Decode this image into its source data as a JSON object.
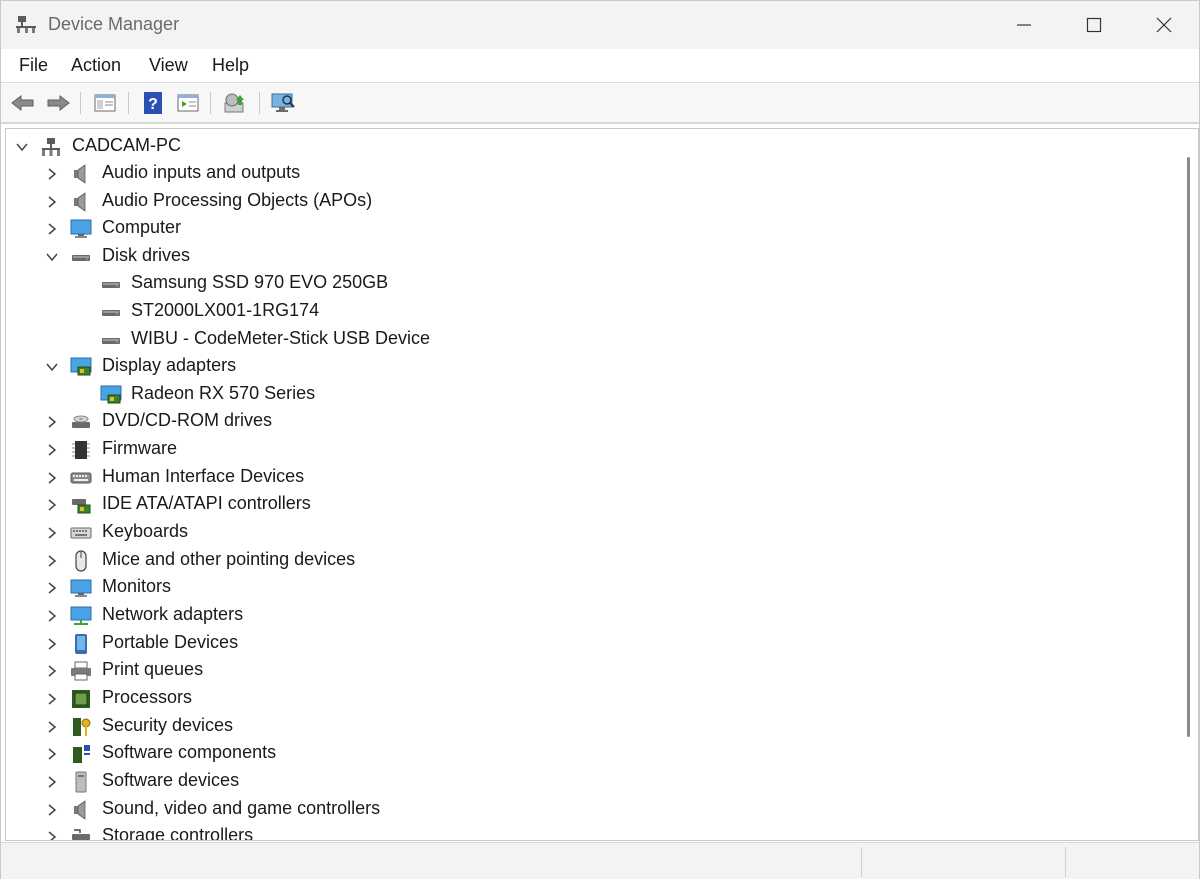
{
  "window": {
    "title": "Device Manager"
  },
  "menu": {
    "items": [
      "File",
      "Action",
      "View",
      "Help"
    ]
  },
  "toolbar": {
    "buttons": [
      "back-arrow-icon",
      "forward-arrow-icon",
      "properties-panel-icon",
      "help-icon",
      "details-panel-icon",
      "update-driver-icon",
      "scan-hardware-icon"
    ]
  },
  "tree": {
    "root": "CADCAM-PC",
    "items": [
      {
        "label": "Audio inputs and outputs",
        "icon": "speaker-icon",
        "expanded": false
      },
      {
        "label": "Audio Processing Objects (APOs)",
        "icon": "speaker-icon",
        "expanded": false
      },
      {
        "label": "Computer",
        "icon": "computer-icon",
        "expanded": false
      },
      {
        "label": "Disk drives",
        "icon": "disk-drive-icon",
        "expanded": true
      },
      {
        "label": "Samsung SSD 970 EVO 250GB",
        "icon": "disk-drive-icon",
        "child": true
      },
      {
        "label": "ST2000LX001-1RG174",
        "icon": "disk-drive-icon",
        "child": true
      },
      {
        "label": "WIBU - CodeMeter-Stick USB Device",
        "icon": "disk-drive-icon",
        "child": true
      },
      {
        "label": "Display adapters",
        "icon": "display-adapter-icon",
        "expanded": true
      },
      {
        "label": "Radeon RX 570 Series",
        "icon": "display-adapter-icon",
        "child": true
      },
      {
        "label": "DVD/CD-ROM drives",
        "icon": "dvd-drive-icon",
        "expanded": false
      },
      {
        "label": "Firmware",
        "icon": "firmware-chip-icon",
        "expanded": false
      },
      {
        "label": "Human Interface Devices",
        "icon": "hid-icon",
        "expanded": false
      },
      {
        "label": "IDE ATA/ATAPI controllers",
        "icon": "ide-controller-icon",
        "expanded": false
      },
      {
        "label": "Keyboards",
        "icon": "keyboard-icon",
        "expanded": false
      },
      {
        "label": "Mice and other pointing devices",
        "icon": "mouse-icon",
        "expanded": false
      },
      {
        "label": "Monitors",
        "icon": "monitor-icon",
        "expanded": false
      },
      {
        "label": "Network adapters",
        "icon": "network-adapter-icon",
        "expanded": false
      },
      {
        "label": "Portable Devices",
        "icon": "portable-device-icon",
        "expanded": false
      },
      {
        "label": "Print queues",
        "icon": "printer-icon",
        "expanded": false
      },
      {
        "label": "Processors",
        "icon": "processor-icon",
        "expanded": false
      },
      {
        "label": "Security devices",
        "icon": "security-key-icon",
        "expanded": false
      },
      {
        "label": "Software components",
        "icon": "software-component-icon",
        "expanded": false
      },
      {
        "label": "Software devices",
        "icon": "software-device-icon",
        "expanded": false
      },
      {
        "label": "Sound, video and game controllers",
        "icon": "speaker-icon",
        "expanded": false
      },
      {
        "label": "Storage controllers",
        "icon": "storage-controller-icon",
        "expanded": false
      }
    ]
  },
  "colors": {
    "accent": "#0078d4",
    "chevron": "#444444"
  }
}
